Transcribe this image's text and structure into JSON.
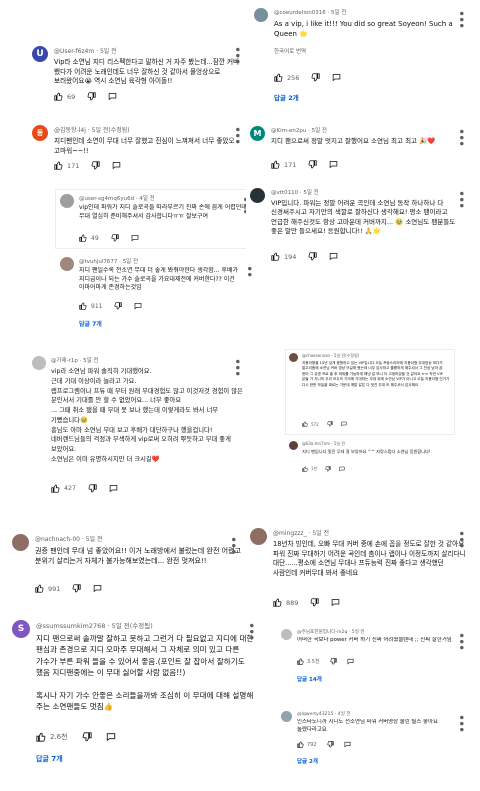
{
  "comments": [
    {
      "handle": "@User-f6z4m",
      "time": "5일 전",
      "avatar": "U",
      "color": "#3949ab",
      "text": "Vip라 소연님 지디 리스펙한다고 말하신 거 자주 봤는데...잠깐 커버 뵀다가 어려운 노래인데도 너무 잘하신 것 같아서 몰엉상으로 보러왔어요😭 역시 소연님 육각형 아이돌!!",
      "likes": "69"
    },
    {
      "handle": "@김동항-l4j",
      "time": "5일 전(수정됨)",
      "avatar": "동",
      "color": "#e64a19",
      "text": "지디팬인데 소연이 무대 너무 잘했고 진심이 느껴져서 너무 좋았오 고마워~~!!",
      "likes": "171"
    },
    {
      "handle": "@user-sg4mq6yu6d",
      "time": "4일 전",
      "avatar": "",
      "color": "#9e9e9e",
      "text": "vip인데 파워가 지디 솔로곡들 따라부르기 진짜 손에 꼽게 어렵던데 무대 열심히 준비해주셔서 감사합니다ㅠㅠ 잘보구여",
      "likes": "49"
    },
    {
      "handle": "@tvuhjul7677",
      "time": "5일 전",
      "avatar": "",
      "color": "#a1887f",
      "text": "지디 팬일수록 전소연 무대 더 좋게 봐줘야한다 생각함... 후배가 지디급이나 되는 가수 솔로곡을 가요대제전에 커버한다?? 이건 아마어마게 존경하는것임",
      "likes": "911",
      "replies": "답글 7개"
    },
    {
      "handle": "@가제-r1p",
      "time": "5일 전",
      "avatar": "",
      "color": "#bdbdbd",
      "text": "vip라 소연님 파워 솔직히 기대했어요.\n근데 기대 이상이라 놀라고 가요.\n랩프로그램이나 프듀 때 부터 원래 무대경험도 많고 이것저것 경험이 많은 분인서서 기대를 안 할 수 없었어요... 너무 좋아요\n... 그때 취소 됐을 때 무대 못 보나 했는데 이렇게라도 봐서 너무 기뻤습니다🥹\n흥님도 아마 소연님 무대 보고 후배가 대단하구나 했을겁니다!\n네버랜드님들의 걱정과 무색하게 vip로써 오히려 뿌듯하고 무대 좋게 보았어요.\n소연님은 이미 유명하시지만 더 크시길❤️",
      "likes": "427"
    },
    {
      "handle": "@nachnach-00",
      "time": "5일 전",
      "avatar": "",
      "color": "#8d6e63",
      "text": "권증 팬인데 무대 넘 좋았어요!! 이거 노래방에서 불렀는데 완전 어렵고 분위기 살리는거 자체가 불가능해보였는데... 완전 멋져요!!",
      "likes": "991"
    },
    {
      "handle": "@ssumssumkim2768",
      "time": "5일 전(수정됨)",
      "avatar": "S",
      "color": "#7e57c2",
      "text": "지디 팬으로써 솔까말 잘하고 못하고 그런거 다 필요없고 지디에 대한 팬심과 존경으로 지디 오마주 무대해서 그 자체로 의미 있고 다른 가수가 부른 파워 들을 수 있어서 좋음.(포인트 잘 잡아서 잘하기도 했음 지디팬중에는 이 무대 싫어할 사람 없음!!)\n\n혹시나 자기 가수 안좋은 소리들을까봐 조심히 이 무대에 대해 설명해 주는 소연팬들도 멋짐👍",
      "likes": "2.6천",
      "replies": "답글 7개"
    },
    {
      "handle": "@coeurdelion0316",
      "time": "5일 전",
      "avatar": "",
      "color": "#78909c",
      "text": "As a vip, i like it!!! You did so great Soyeon! Such a Queen 🌟",
      "translate": "한국어로 번역",
      "likes": "256",
      "replies": "답글 2개"
    },
    {
      "handle": "@Kim-en2pu",
      "time": "5일 전",
      "avatar": "M",
      "color": "#00897b",
      "text": "지디 팬으로써 정말 멋지고 잘했어요 소연님 최고 최고 🎉❤️",
      "likes": "171"
    },
    {
      "handle": "@vtt0110",
      "time": "5일 전",
      "avatar": "",
      "color": "#263238",
      "text": "VIP입니다. 파워는 정말 어려운 곡인데 소연님 동작 하나하나 다 신경써주시고 자기만의 색깔로 잘하신다 생각해요! 평소 팬이라고 언급한 해주신것도 항상 고마운데 커버까지... 🥹 소연님도 팬분들도 좋은 말만 들으세요! 응원합니다!! 🙏🌟",
      "likes": "194"
    },
    {
      "handle": "@chaesenvan",
      "time": "5일 전(수정됨)",
      "avatar": "",
      "color": "#6d4c41",
      "text": "지용이형을 10년 넘게 응원하고 있는 VIP입니다 오늘 프랑스리어에 지용이형 무대영상 보다가 알고리즘에 소연님 커버 영상 뜨길래 봤는데 너무 감사하고 훌륭하게 해주셔서 그 잔상 남아 곱 한미 그 유명 프로 출 후 파워를 가능하게 해낸 걸 보니 더 고생하셨을 것 같아요 ㅠㅠ 작년 VIP 분들 가 지니의 우리 모두의 기억에 기대하는 무대 위에 소연님 VIP가 아니고 오늘 지용이형 인기가 다시 한번 하늘을 찌르는 가운데 깨알 같은 다 멋진 무대 또 해주셔서 감사해요",
      "likes": "572"
    },
    {
      "handle": "@Ella-mn7nm",
      "time": "5일 전",
      "avatar": "",
      "color": "#5d4037",
      "text": "지디 팬입니다 멋진 무대 잘 보았어요 ^^ 자랑스럽다 소연님 응원합니다!",
      "likes": "1천"
    },
    {
      "handle": "@mingzzz_",
      "time": "5일 전",
      "avatar": "",
      "color": "#8d6e63",
      "text": "18년차 빙인데, 오빠 무대 커버 중에 손에 꼽을 정도로 잘한 것 같아요 파워 진짜 무대하기 어려운 곡인데 춤이나 랩이나 이정도까지 살리다니 대단......평소에 소연님 무대나 프듀능력 진짜 좋다고 생각했던 사람인데 커버무대 봐서 좋네요",
      "likes": "889"
    },
    {
      "handle": "@주님포한원입니다-m2q",
      "time": "5일 전",
      "avatar": "",
      "color": "#bdbdbd",
      "text": "어떠한 곡보다 power 커버 하기 진짜 어려웠을텐데 ;; 진짜 잘한거임",
      "likes": "3.5천",
      "replies": "답글 14개"
    },
    {
      "handle": "@lqwerty43215",
      "time": "4일 전",
      "avatar": "",
      "color": "#90a4ae",
      "text": "인스타도니까 지디도 전소연님 파워 커버영상 올린 릴스 좋아요 눌렸다라고요",
      "likes": "792",
      "replies": "답글 2개"
    }
  ]
}
